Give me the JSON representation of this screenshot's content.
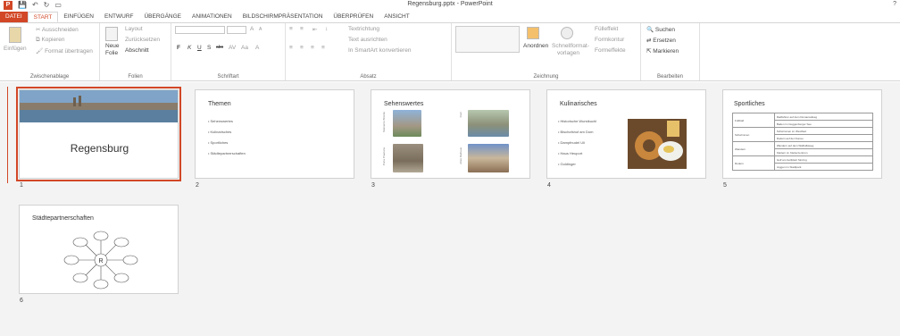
{
  "app": {
    "document_title": "Regensburg.pptx - PowerPoint",
    "help": "?"
  },
  "tabs": [
    "DATEI",
    "START",
    "EINFÜGEN",
    "ENTWURF",
    "ÜBERGÄNGE",
    "ANIMATIONEN",
    "BILDSCHIRMPRÄSENTATION",
    "ÜBERPRÜFEN",
    "ANSICHT"
  ],
  "ribbon": {
    "clipboard": {
      "paste": "Einfügen",
      "cut": "Ausschneiden",
      "copy": "Kopieren",
      "format": "Format übertragen",
      "label": "Zwischenablage"
    },
    "slides": {
      "new": "Neue",
      "new2": "Folie",
      "layout": "Layout",
      "reset": "Zurücksetzen",
      "section": "Abschnitt",
      "label": "Folien"
    },
    "font": {
      "bold": "F",
      "italic": "K",
      "underline": "U",
      "shadow": "S",
      "strike": "abc",
      "spacing": "AV",
      "case": "Aa",
      "grow": "A",
      "shrink": "A",
      "color": "A",
      "label": "Schriftart"
    },
    "paragraph": {
      "direction": "Textrichtung",
      "align": "Text ausrichten",
      "smartart": "In SmartArt konvertieren",
      "label": "Absatz"
    },
    "drawing": {
      "arrange": "Anordnen",
      "quick": "Schnellformat-",
      "quick2": "vorlagen",
      "fill": "Fülleffekt",
      "outline": "Formkontur",
      "effects": "Formeffekte",
      "label": "Zeichnung"
    },
    "editing": {
      "find": "Suchen",
      "replace": "Ersetzen",
      "select": "Markieren",
      "label": "Bearbeiten"
    }
  },
  "slides": [
    {
      "number": "1",
      "title": "Regensburg"
    },
    {
      "number": "2",
      "title": "Themen",
      "bullets": [
        "Sehenswertes",
        "Kulinarisches",
        "Sportliches",
        "Städtepartnerschaften"
      ]
    },
    {
      "number": "3",
      "title": "Sehenswertes",
      "captions": [
        "Steinerne Brücke",
        "Dom",
        "Porta Praetoria",
        "Altes Rathaus"
      ]
    },
    {
      "number": "4",
      "title": "Kulinarisches",
      "bullets": [
        "Historische Wurstkuchl",
        "Bischofshof am Dom",
        "Dampfnudel Uli",
        "Haus Heuport",
        "Goldinger"
      ]
    },
    {
      "number": "5",
      "title": "Sportliches",
      "rows": [
        [
          "Fußball",
          "Radfahren auf dem Donauradweg",
          "Baden im Guggenberger See"
        ],
        [
          "Schwimmen",
          "Schwimmen im Westbad",
          "Rudern auf der Donau"
        ],
        [
          "Wandern",
          "Wandern auf dem Walhallaweg",
          "Klettern im Kletterzentrum"
        ],
        [
          "Rudern",
          "Golf am Golfplatz Sinzing",
          "Joggen im Stadtpark"
        ]
      ]
    },
    {
      "number": "6",
      "title": "Städtepartnerschaften",
      "center": "R"
    }
  ]
}
